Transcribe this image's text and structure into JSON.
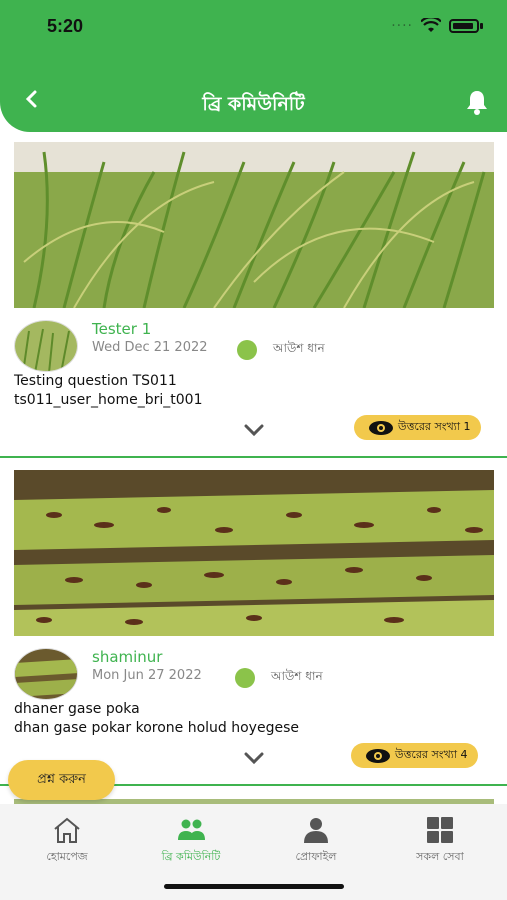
{
  "status_bar": {
    "time": "5:20"
  },
  "header": {
    "title": "ব্রি কমিউনিটি"
  },
  "posts": [
    {
      "author": "Tester 1",
      "date": "Wed Dec 21 2022",
      "crop": "আউশ ধান",
      "question_title": "Testing question TS011",
      "question_body": "ts011_user_home_bri_t001",
      "answer_count_label": "উত্তরের সংখ্যা 1"
    },
    {
      "author": "shaminur",
      "date": "Mon Jun 27 2022",
      "crop": "আউশ ধান",
      "question_title": "dhaner gase poka",
      "question_body": "dhan gase pokar korone holud hoyegese",
      "answer_count_label": "উত্তরের সংখ্যা 4"
    }
  ],
  "ask_button": "প্রশ্ন করুন",
  "bottom_nav": [
    {
      "label": "হোমপেজ",
      "icon": "home-icon"
    },
    {
      "label": "ব্রি কমিউনিটি",
      "icon": "community-icon"
    },
    {
      "label": "প্রোফাইল",
      "icon": "profile-icon"
    },
    {
      "label": "সকল সেবা",
      "icon": "grid-icon"
    }
  ],
  "colors": {
    "primary": "#3fb34f",
    "accent": "#f2c94c"
  }
}
